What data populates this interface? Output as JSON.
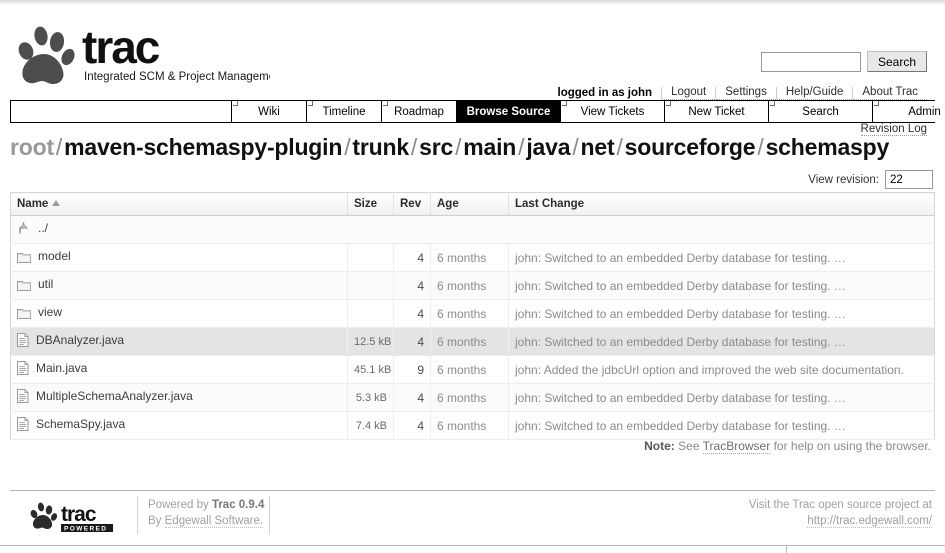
{
  "site": {
    "logo_text": "trac",
    "tagline": "Integrated SCM & Project Management"
  },
  "search": {
    "value": "",
    "placeholder": "",
    "button_label": "Search"
  },
  "metanav": {
    "logged_in": "logged in as john",
    "links": [
      {
        "label": "Logout"
      },
      {
        "label": "Settings"
      },
      {
        "label": "Help/Guide"
      },
      {
        "label": "About Trac"
      }
    ]
  },
  "mainnav": {
    "tabs": [
      {
        "label": "Wiki",
        "active": false
      },
      {
        "label": "Timeline",
        "active": false
      },
      {
        "label": "Roadmap",
        "active": false
      },
      {
        "label": "Browse Source",
        "active": true
      },
      {
        "label": "View Tickets",
        "active": false
      },
      {
        "label": "New Ticket",
        "active": false
      },
      {
        "label": "Search",
        "active": false
      },
      {
        "label": "Admin",
        "active": false
      }
    ]
  },
  "ctxnav": {
    "revision_log_label": "Revision Log"
  },
  "path": {
    "root_label": "root",
    "separator": "/",
    "segments": [
      "maven-schemaspy-plugin",
      "trunk",
      "src",
      "main",
      "java",
      "net",
      "sourceforge",
      "schemaspy"
    ]
  },
  "revision_form": {
    "label": "View revision:",
    "value": "22"
  },
  "dirlist": {
    "columns": {
      "name": "Name",
      "size": "Size",
      "rev": "Rev",
      "age": "Age",
      "change": "Last Change"
    },
    "sort": {
      "column": "Name",
      "direction": "ascending",
      "indicator": "▲"
    },
    "parent_entry": {
      "name": "../",
      "icon": "parent-directory-icon"
    },
    "rows": [
      {
        "name": "model",
        "kind": "folder",
        "icon": "folder-icon",
        "size": "",
        "rev": "4",
        "age": "6 months",
        "change": "john: Switched to an embedded Derby database for testing. …",
        "highlighted": false
      },
      {
        "name": "util",
        "kind": "folder",
        "icon": "folder-icon",
        "size": "",
        "rev": "4",
        "age": "6 months",
        "change": "john: Switched to an embedded Derby database for testing. …",
        "highlighted": false
      },
      {
        "name": "view",
        "kind": "folder",
        "icon": "folder-icon",
        "size": "",
        "rev": "4",
        "age": "6 months",
        "change": "john: Switched to an embedded Derby database for testing. …",
        "highlighted": false
      },
      {
        "name": "DBAnalyzer.java",
        "kind": "file",
        "icon": "file-icon",
        "size": "12.5 kB",
        "rev": "4",
        "age": "6 months",
        "change": "john: Switched to an embedded Derby database for testing. …",
        "highlighted": true
      },
      {
        "name": "Main.java",
        "kind": "file",
        "icon": "file-icon",
        "size": "45.1 kB",
        "rev": "9",
        "age": "6 months",
        "change": "john: Added the jdbcUrl option and improved the web site documentation.",
        "highlighted": false
      },
      {
        "name": "MultipleSchemaAnalyzer.java",
        "kind": "file",
        "icon": "file-icon",
        "size": "5.3 kB",
        "rev": "4",
        "age": "6 months",
        "change": "john: Switched to an embedded Derby database for testing. …",
        "highlighted": false
      },
      {
        "name": "SchemaSpy.java",
        "kind": "file",
        "icon": "file-icon",
        "size": "7.4 kB",
        "rev": "4",
        "age": "6 months",
        "change": "john: Switched to an embedded Derby database for testing. …",
        "highlighted": false
      }
    ]
  },
  "note": {
    "prefix": "Note:",
    "text_before": "See",
    "link": "TracBrowser",
    "text_after": "for help on using the browser."
  },
  "footer": {
    "logo_text": "trac",
    "logo_badge": "POWERED",
    "powered_by_prefix": "Powered by",
    "powered_by_product": "Trac 0.9.4",
    "by_prefix": "By",
    "by_company": "Edgewall Software.",
    "visit_text": "Visit the Trac open source project at",
    "visit_url": "http://trac.edgewall.com/"
  },
  "colors": {
    "active_tab_bg": "#000000",
    "highlight_row": "#e4e4e4",
    "muted_text": "#8b8b8b",
    "path_root": "#999999"
  }
}
